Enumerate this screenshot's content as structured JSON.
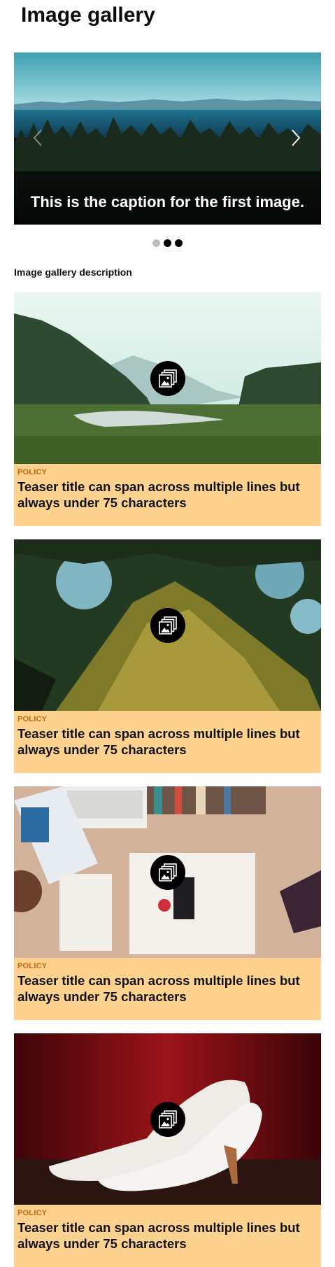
{
  "page": {
    "title": "Image gallery",
    "description": "Image gallery description"
  },
  "slideshow": {
    "caption": "This is the caption for the first image.",
    "prev_icon": "chevron-left-icon",
    "next_icon": "chevron-right-icon",
    "dots": [
      "inactive",
      "active",
      "active"
    ]
  },
  "teasers": [
    {
      "category": "POLICY",
      "title": "Teaser title can span across multiple lines but always under 75 characters",
      "icon": "image-gallery-icon"
    },
    {
      "category": "POLICY",
      "title": "Teaser title can span across multiple lines but always under 75 characters",
      "icon": "image-gallery-icon"
    },
    {
      "category": "POLICY",
      "title": "Teaser title can span across multiple lines but always under 75 characters",
      "icon": "image-gallery-icon"
    },
    {
      "category": "POLICY",
      "title": "Teaser title can span across multiple lines but always under 75 characters",
      "icon": "image-gallery-icon"
    }
  ],
  "colors": {
    "teaser_background": "#fdd28f",
    "category_text": "#c8650b",
    "dot_active": "#000000",
    "dot_inactive": "#bcbcbc"
  }
}
